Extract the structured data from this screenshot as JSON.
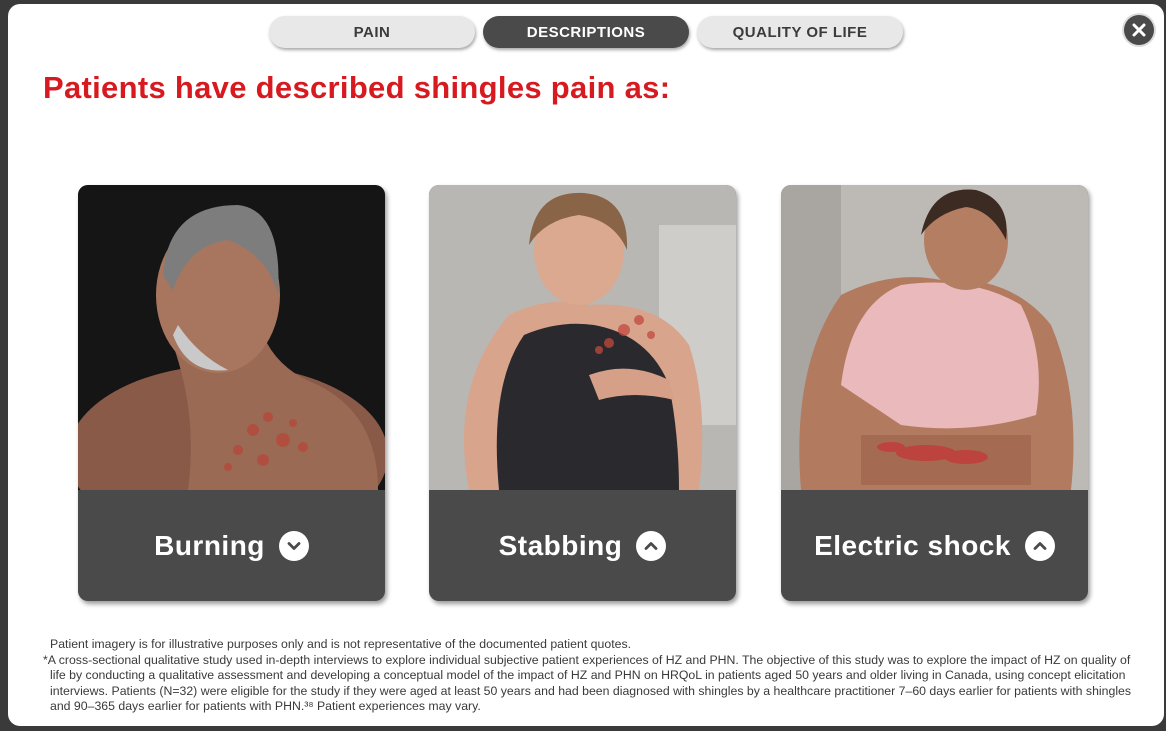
{
  "tabs": [
    {
      "label": "PAIN",
      "active": false
    },
    {
      "label": "DESCRIPTIONS",
      "active": true
    },
    {
      "label": "QUALITY OF LIFE",
      "active": false
    }
  ],
  "close_icon": "close-icon",
  "headline": "Patients have described shingles pain as:",
  "cards": [
    {
      "label": "Burning",
      "chevron": "chevron-down-icon"
    },
    {
      "label": "Stabbing",
      "chevron": "chevron-up-icon"
    },
    {
      "label": "Electric shock",
      "chevron": "chevron-up-icon"
    }
  ],
  "footnotes": {
    "imagery": "Patient imagery is for illustrative purposes only and is not representative of the documented patient quotes.",
    "study": "*A cross-sectional qualitative study used in-depth interviews to explore individual subjective patient experiences of HZ and PHN. The objective of this study was to explore the impact of HZ on quality of life by conducting a qualitative assessment and developing a conceptual model of the impact of HZ and PHN on HRQoL in patients aged 50 years and older living in Canada, using concept elicitation interviews. Patients (N=32) were eligible for the study if they were aged at least 50 years and had been diagnosed with shingles by a healthcare practitioner 7–60 days earlier for patients with shingles and 90–365 days earlier for patients with PHN.³⁸ Patient experiences may vary."
  },
  "colors": {
    "accent": "#d71920",
    "dark": "#4a4a4a",
    "tab_inactive": "#e8e8e8"
  }
}
